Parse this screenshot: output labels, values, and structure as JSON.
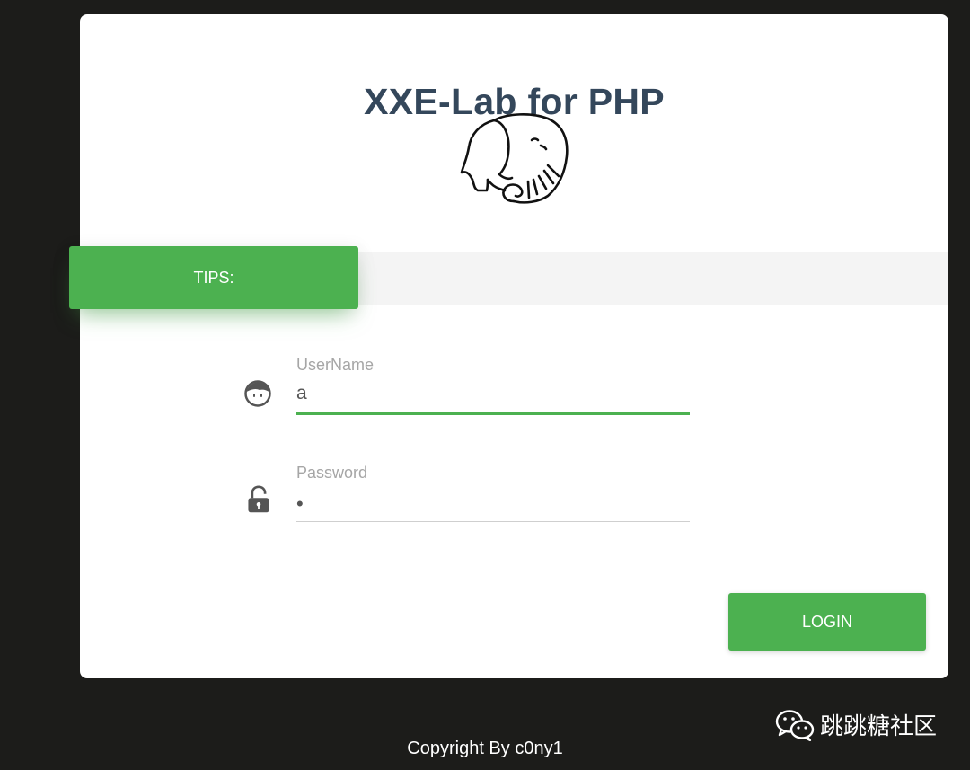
{
  "app": {
    "title": "XXE-Lab for PHP"
  },
  "tips": {
    "label": "TIPS:"
  },
  "form": {
    "username": {
      "label": "UserName",
      "value": "a",
      "icon": "user-face-icon"
    },
    "password": {
      "label": "Password",
      "value": "•",
      "icon": "unlock-icon"
    },
    "login_label": "LOGIN"
  },
  "footer": {
    "copyright": "Copyright By c0ny1",
    "watermark": "跳跳糖社区"
  },
  "colors": {
    "accent": "#4cb150",
    "title": "#34475b",
    "background": "#1c1c1a"
  }
}
